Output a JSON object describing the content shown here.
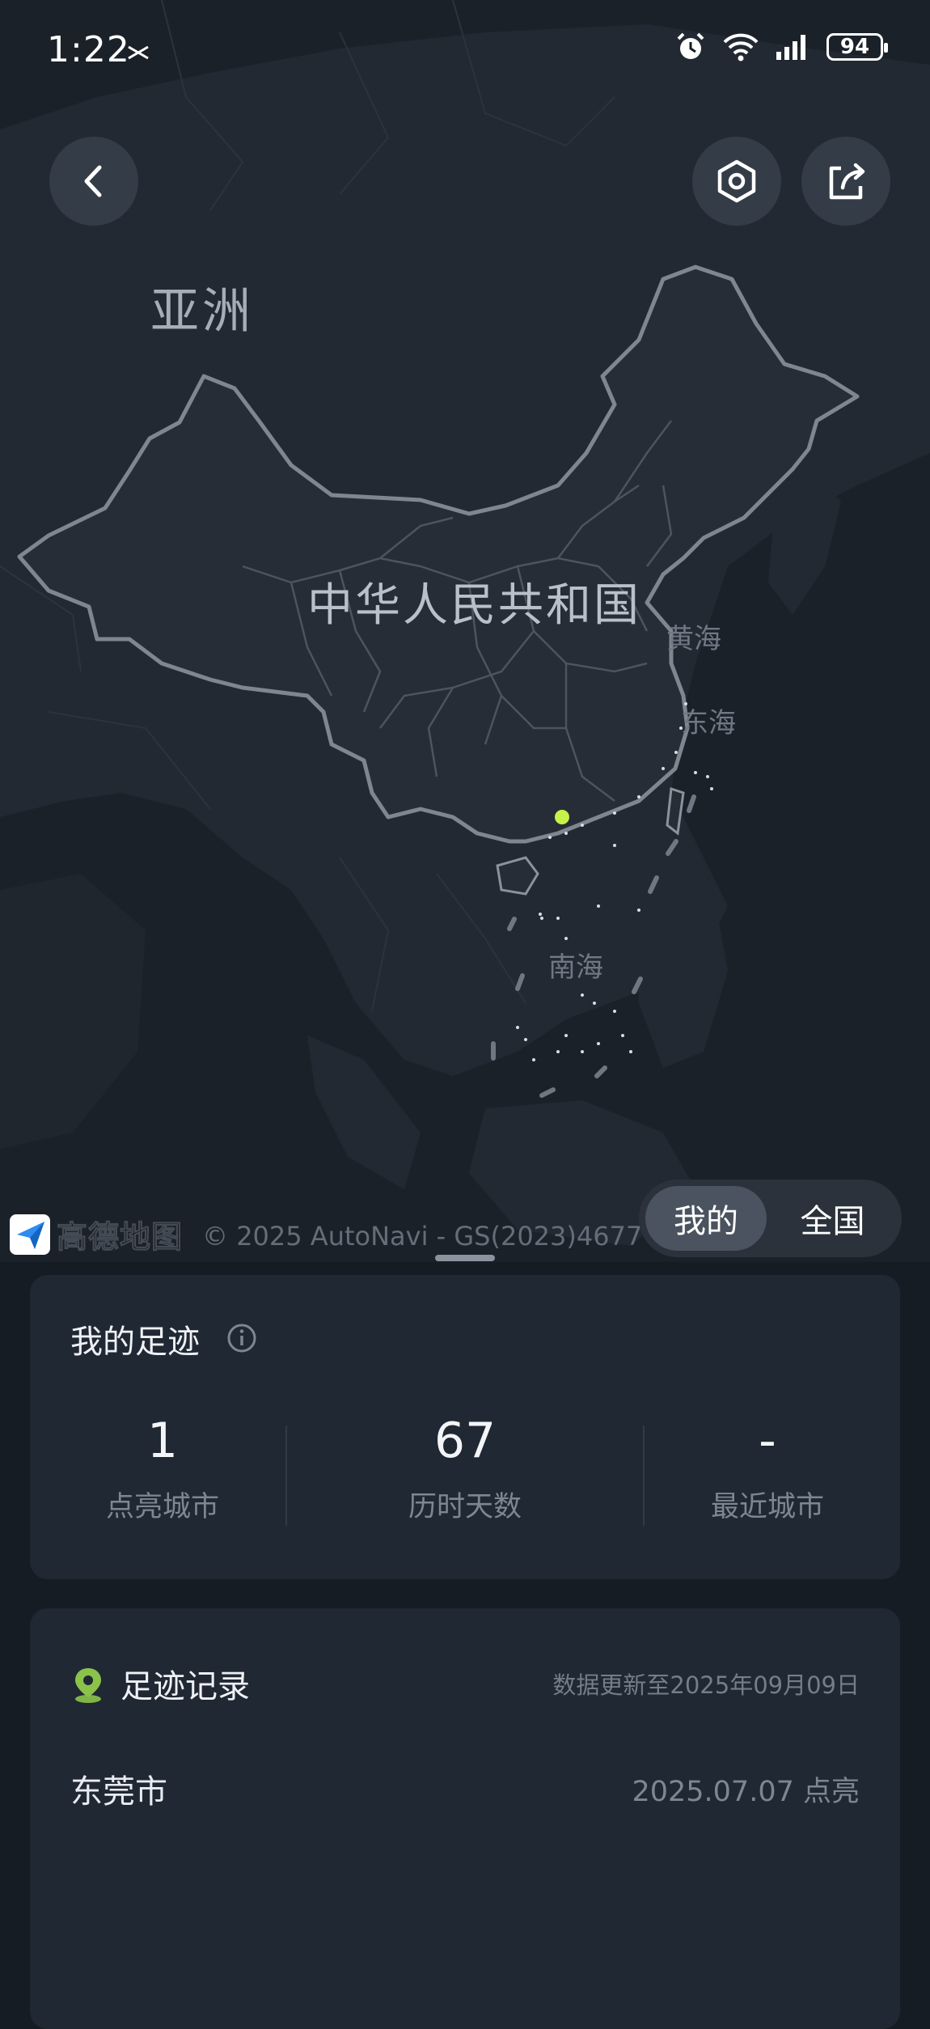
{
  "status_bar": {
    "time": "1:22",
    "battery": "94",
    "icons": [
      "notification-icon",
      "alarm-icon",
      "wifi-icon",
      "signal-icon",
      "battery-icon"
    ]
  },
  "map": {
    "labels": {
      "continent": "亚洲",
      "country": "中华人民共和国",
      "yellow_sea": "黄海",
      "east_sea": "东海",
      "south_sea": "南海"
    },
    "attribution": {
      "logo_text": "高德地图",
      "copyright": "© 2025 AutoNavi - GS(2023)4677号"
    },
    "marker_color": "#c6f24a"
  },
  "toggle": {
    "options": [
      "我的",
      "全国"
    ],
    "selected": "我的"
  },
  "footprint": {
    "title": "我的足迹",
    "stats": [
      {
        "value": "1",
        "label": "点亮城市"
      },
      {
        "value": "67",
        "label": "历时天数"
      },
      {
        "value": "-",
        "label": "最近城市"
      }
    ]
  },
  "records": {
    "title": "足迹记录",
    "updated": "数据更新至2025年09月09日",
    "items": [
      {
        "city": "东莞市",
        "date": "2025.07.07 点亮"
      }
    ]
  },
  "colors": {
    "accent_green": "#8bc34a",
    "card_bg": "#202833",
    "map_bg": "#1b2129"
  }
}
